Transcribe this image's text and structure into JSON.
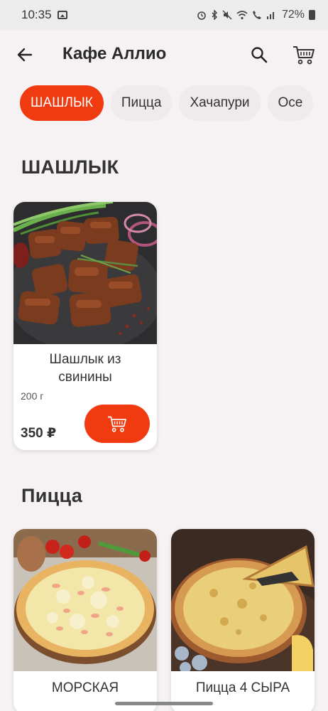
{
  "status_bar": {
    "time": "10:35",
    "battery": "72%",
    "icons": [
      "gallery-icon",
      "alarm-icon",
      "bluetooth-icon",
      "mute-icon",
      "wifi-icon",
      "call-icon",
      "signal-icon",
      "battery-icon"
    ]
  },
  "header": {
    "title": "Кафе Аллио",
    "back_icon": "back-arrow-icon",
    "search_icon": "search-icon",
    "cart_icon": "cart-icon"
  },
  "categories": [
    {
      "label": "ШАШЛЫК",
      "active": true
    },
    {
      "label": "Пицца",
      "active": false
    },
    {
      "label": "Хачапури",
      "active": false
    },
    {
      "label": "Осе",
      "active": false
    }
  ],
  "sections": [
    {
      "title": "ШАШЛЫК",
      "items": [
        {
          "name_line1": "Шашлык из",
          "name_line2": "свинины",
          "weight": "200 г",
          "price": "350 ₽"
        }
      ]
    },
    {
      "title": "Пицца",
      "items": [
        {
          "name": "МОРСКАЯ"
        },
        {
          "name": "Пицца 4 СЫРА"
        }
      ]
    }
  ],
  "colors": {
    "accent": "#f03a0f",
    "background": "#f6f2f4",
    "chip": "#efeaec"
  }
}
